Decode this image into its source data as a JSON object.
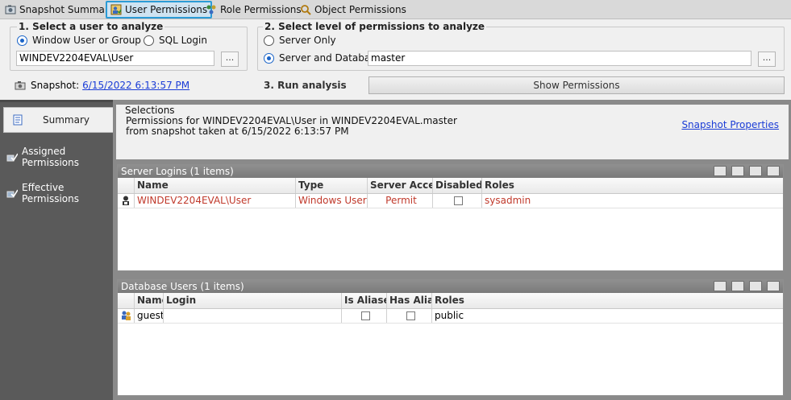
{
  "toolbar": {
    "tabs": [
      {
        "label": "Snapshot Summary",
        "icon": "snapshot-icon"
      },
      {
        "label": "User Permissions",
        "icon": "user-permissions-icon",
        "active": true
      },
      {
        "label": "Role Permissions",
        "icon": "role-permissions-icon"
      },
      {
        "label": "Object Permissions",
        "icon": "object-permissions-icon"
      }
    ]
  },
  "step1": {
    "title": "1. Select a user to analyze",
    "radio_window": "Window User or Group",
    "radio_sql": "SQL Login",
    "user_value": "WINDEV2204EVAL\\User",
    "browse_label": "..."
  },
  "step2": {
    "title": "2. Select level of permissions to analyze",
    "radio_server_only": "Server Only",
    "radio_server_db": "Server and Database",
    "db_value": "master",
    "browse_label": "..."
  },
  "snapshot": {
    "label": "Snapshot:",
    "link": "6/15/2022 6:13:57 PM"
  },
  "step3": {
    "title": "3. Run analysis",
    "button": "Show Permissions"
  },
  "nav": {
    "items": [
      {
        "label": "Summary"
      },
      {
        "label": "Assigned Permissions"
      },
      {
        "label": "Effective Permissions"
      }
    ]
  },
  "selections": {
    "title": "Selections",
    "line1": "Permissions for WINDEV2204EVAL\\User in WINDEV2204EVAL.master",
    "line2": "from snapshot taken at 6/15/2022 6:13:57 PM",
    "props_link": "Snapshot Properties"
  },
  "server_logins": {
    "title": "Server Logins (1 items)",
    "columns": [
      "Name",
      "Type",
      "Server Access",
      "Disabled",
      "Roles"
    ],
    "rows": [
      {
        "name": "WINDEV2204EVAL\\User",
        "type": "Windows User",
        "access": "Permit",
        "disabled": false,
        "roles": "sysadmin"
      }
    ]
  },
  "database_users": {
    "title": "Database Users (1 items)",
    "columns": [
      "Name",
      "Login",
      "Is Aliased",
      "Has Alias",
      "Roles"
    ],
    "rows": [
      {
        "name": "guest",
        "login": "",
        "is_aliased": false,
        "has_alias": false,
        "roles": "public"
      }
    ]
  },
  "colors": {
    "accent": "#2b9bd6",
    "link": "#1a3cd6",
    "login_row_text": "#c0392b"
  }
}
